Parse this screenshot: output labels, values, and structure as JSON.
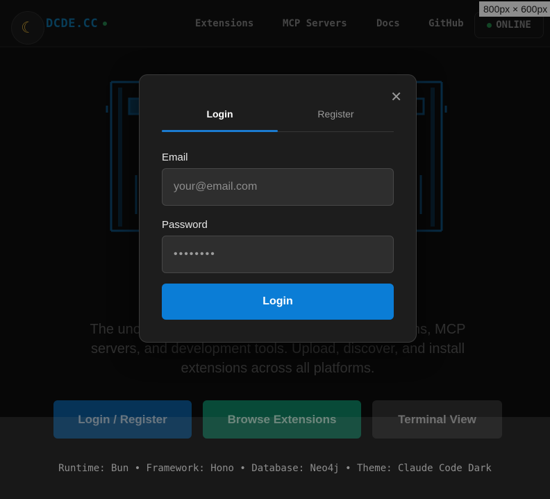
{
  "header": {
    "brand": "DCDE.CC",
    "logo_icon": "moon-icon",
    "nav": [
      "Extensions",
      "MCP Servers",
      "Docs",
      "GitHub"
    ],
    "status": "ONLINE",
    "status_color": "#1d6b3a"
  },
  "devtools_tooltip": "800px × 600px",
  "hero": {
    "tagline": "The unofficial marketplace for Claude Code extensions, MCP servers, and development tools. Upload, discover, and install extensions across all platforms."
  },
  "actions": {
    "login_register": "Login / Register",
    "browse": "Browse Extensions",
    "terminal": "Terminal View"
  },
  "footer": {
    "text": "Runtime: Bun • Framework: Hono • Database: Neo4j • Theme: Claude Code Dark"
  },
  "modal": {
    "close_icon": "close-icon",
    "tabs": [
      {
        "label": "Login",
        "active": true
      },
      {
        "label": "Register",
        "active": false
      }
    ],
    "email": {
      "label": "Email",
      "placeholder": "your@email.com",
      "value": ""
    },
    "password": {
      "label": "Password",
      "value": "••••••••"
    },
    "submit_label": "Login",
    "accent": "#0b7dd6"
  }
}
